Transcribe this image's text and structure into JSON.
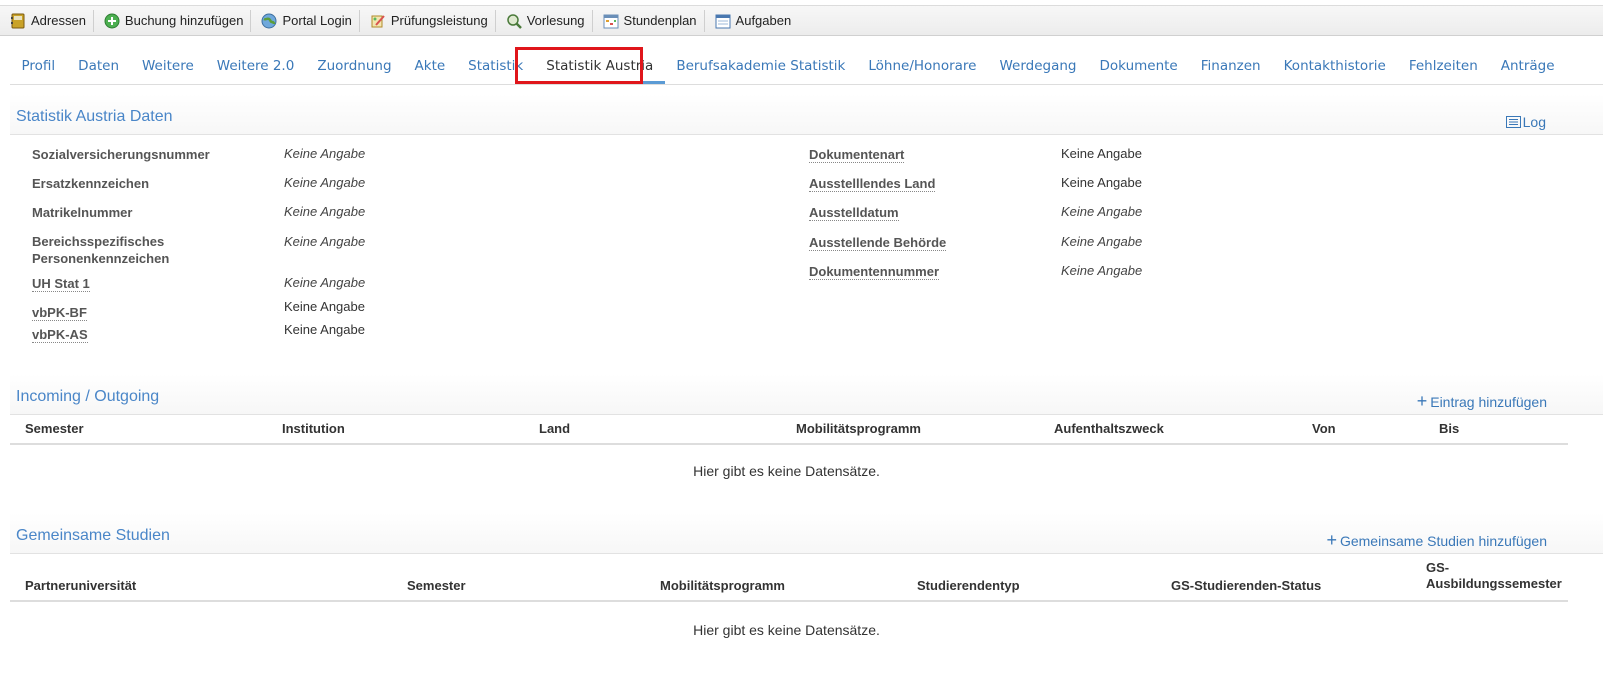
{
  "toolbar": {
    "items": [
      {
        "label": "Adressen",
        "icon": "address-book-icon"
      },
      {
        "label": "Buchung hinzufügen",
        "icon": "add-booking-icon"
      },
      {
        "label": "Portal Login",
        "icon": "globe-icon"
      },
      {
        "label": "Prüfungsleistung",
        "icon": "exam-icon"
      },
      {
        "label": "Vorlesung",
        "icon": "lecture-icon"
      },
      {
        "label": "Stundenplan",
        "icon": "schedule-icon"
      },
      {
        "label": "Aufgaben",
        "icon": "tasks-icon"
      }
    ]
  },
  "tabs": [
    "Profil",
    "Daten",
    "Weitere",
    "Weitere 2.0",
    "Zuordnung",
    "Akte",
    "Statistik",
    "Statistik Austria",
    "Berufsakademie Statistik",
    "Löhne/Honorare",
    "Werdegang",
    "Dokumente",
    "Finanzen",
    "Kontakthistorie",
    "Fehlzeiten",
    "Anträge"
  ],
  "active_tab": "Statistik Austria",
  "statistik": {
    "title": "Statistik Austria Daten",
    "log_label": "Log",
    "left_fields": [
      {
        "label": "Sozialversicherungsnummer",
        "value": "Keine Angabe"
      },
      {
        "label": "Ersatzkennzeichen",
        "value": "Keine Angabe"
      },
      {
        "label": "Matrikelnummer",
        "value": "Keine Angabe"
      },
      {
        "label_line1": "Bereichsspezifisches",
        "label_line2": "Personenkennzeichen",
        "value": "Keine Angabe"
      },
      {
        "label": "UH Stat 1",
        "value": "Keine Angabe"
      },
      {
        "label": "vbPK-BF",
        "value": "Keine Angabe"
      },
      {
        "label": "vbPK-AS",
        "value": "Keine Angabe"
      }
    ],
    "right_fields": [
      {
        "label": "Dokumentenart",
        "value": "Keine Angabe"
      },
      {
        "label": "Ausstelllendes Land",
        "value": "Keine Angabe"
      },
      {
        "label": "Ausstelldatum",
        "value": "Keine Angabe"
      },
      {
        "label": "Ausstellende Behörde",
        "value": "Keine Angabe"
      },
      {
        "label": "Dokumentennummer",
        "value": "Keine Angabe"
      }
    ]
  },
  "incoming": {
    "title": "Incoming / Outgoing",
    "add_label": "Eintrag hinzufügen",
    "columns": [
      "Semester",
      "Institution",
      "Land",
      "Mobilitätsprogramm",
      "Aufenthaltszweck",
      "Von",
      "Bis"
    ],
    "empty_message": "Hier gibt es keine Datensätze."
  },
  "gemeinsame": {
    "title": "Gemeinsame Studien",
    "add_label": "Gemeinsame Studien hinzufügen",
    "columns": [
      "Partneruniversität",
      "Semester",
      "Mobilitätsprogramm",
      "Studierendentyp",
      "GS-Studierenden-Status"
    ],
    "last_column_line1": "GS-",
    "last_column_line2": "Ausbildungssemester",
    "empty_message": "Hier gibt es keine Datensätze."
  },
  "colors": {
    "link": "#3a78b8",
    "title": "#4a86c8",
    "highlight": "#e0161b"
  }
}
